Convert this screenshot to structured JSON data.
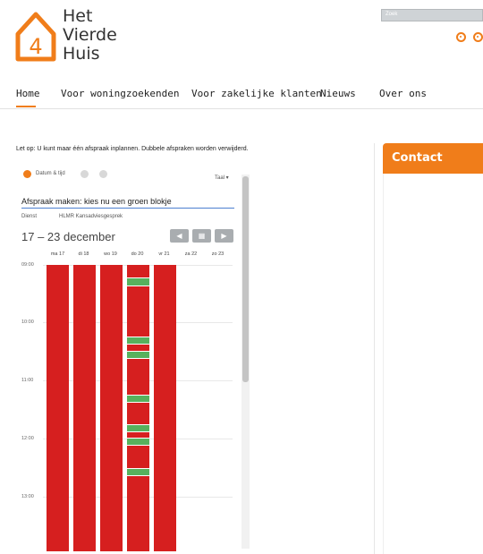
{
  "brand": {
    "name_lines": [
      "Het",
      "Vierde",
      "Huis"
    ],
    "logo_digit": "4",
    "accent": "#f07d1a"
  },
  "search": {
    "placeholder": "Zoek"
  },
  "nav": {
    "items": [
      "Home",
      "Voor woningzoekenden",
      "Voor zakelijke klanten",
      "Nieuws",
      "Over ons"
    ],
    "active_index": 0
  },
  "notice": "Let op: U kunt maar één afspraak inplannen. Dubbele afspraken worden verwijderd.",
  "booking": {
    "step_label": "Datum & tijd",
    "language": "Taal",
    "heading": "Afspraak maken: kies nu een groen blokje",
    "service_label": "Dienst",
    "service_value": "HLMR Kansadviesgesprek",
    "date_range": "17 – 23 december",
    "days": [
      "ma 17",
      "di 18",
      "wo 19",
      "do 20",
      "vr 21",
      "za 22",
      "zo 23"
    ],
    "times": [
      "09:00",
      "10:00",
      "11:00",
      "12:00",
      "13:00"
    ],
    "colors": {
      "unavailable": "#d61f1f",
      "available": "#57b15d"
    },
    "available_slots_do20": [
      "09:15",
      "10:15",
      "10:20",
      "11:15",
      "11:30",
      "11:40",
      "12:15"
    ]
  },
  "contact": {
    "title": "Contact"
  }
}
